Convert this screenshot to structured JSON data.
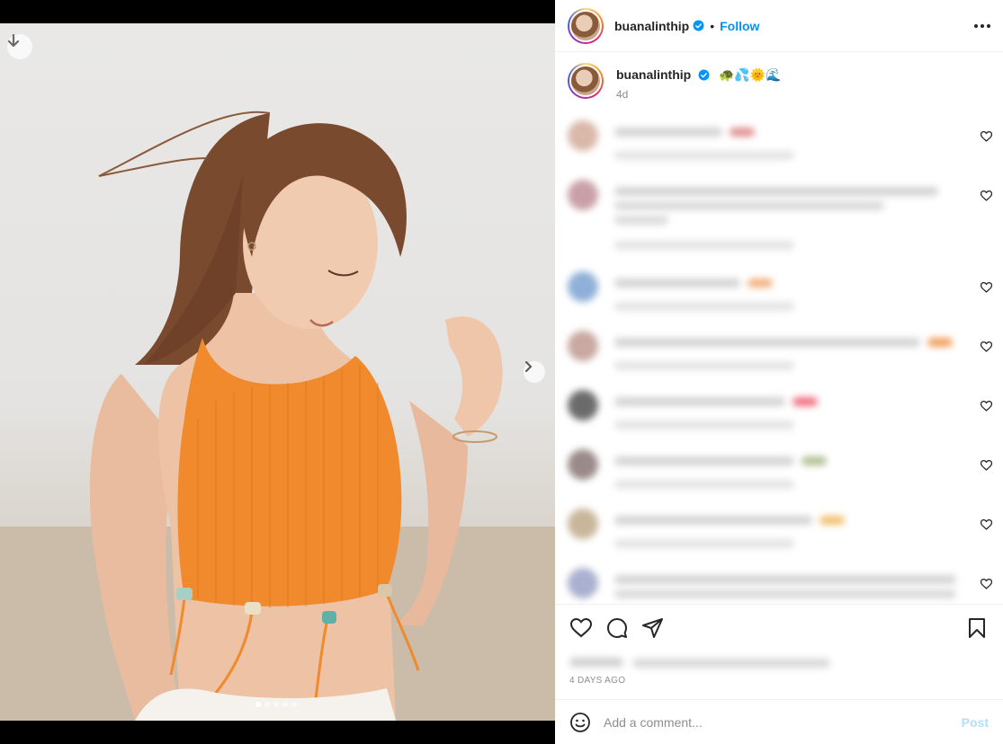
{
  "post": {
    "username": "buanalinthip",
    "follow_label": "Follow",
    "caption_emojis": "🐢💦🌞🌊",
    "time": "4d",
    "days_ago": "4 DAYS AGO",
    "carousel_total": 5,
    "carousel_active": 1
  },
  "composer": {
    "placeholder": "Add a comment...",
    "post_label": "Post"
  },
  "colors": {
    "accent": "#0095f6",
    "post_disabled": "#b2dffc",
    "top_color": "#f08a2c"
  },
  "icons": {
    "download": "download-arrow-icon",
    "next": "chevron-right-icon",
    "verified": "verified-badge-icon",
    "more": "more-options-icon",
    "like": "heart-icon",
    "comment": "comment-icon",
    "share": "share-icon",
    "save": "bookmark-icon",
    "emoji": "emoji-icon"
  }
}
